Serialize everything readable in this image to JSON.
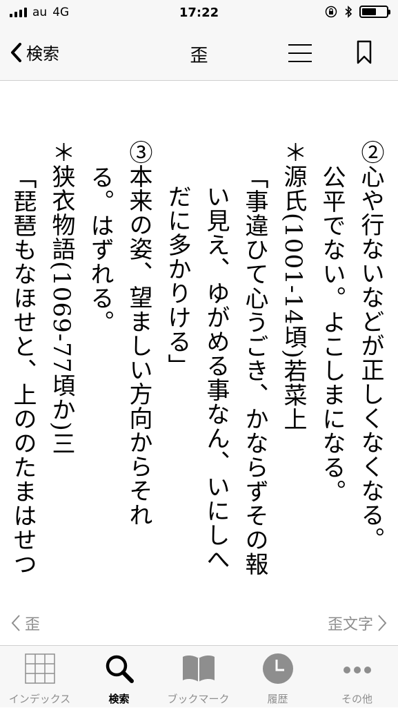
{
  "status": {
    "carrier": "au",
    "network": "4G",
    "time": "17:22"
  },
  "nav": {
    "back_label": "検索",
    "title": "歪"
  },
  "entry": {
    "lines": [
      "②心や行ないなどが正しくなくなる。",
      "公平でない。よこしまになる。",
      "＊源氏(1001‐14頃)若菜上",
      "「事違ひて心うごき、かならずその報",
      "い見え、ゆがめる事なん、いにしへ",
      "だに多かりける」",
      "③本来の姿、望ましい方向からそれ",
      "る。はずれる。",
      "＊狭衣物語(1069‐77頃か)三",
      "「琵琶もなほせと、上ののたまはせつ"
    ]
  },
  "pager": {
    "prev_label": "歪",
    "next_label": "歪文字"
  },
  "tabs": [
    {
      "label": "インデックス",
      "icon": "grid-icon"
    },
    {
      "label": "検索",
      "icon": "search-icon"
    },
    {
      "label": "ブックマーク",
      "icon": "book-icon"
    },
    {
      "label": "履歴",
      "icon": "clock-icon"
    },
    {
      "label": "その他",
      "icon": "more-icon"
    }
  ],
  "colors": {
    "bar_bg": "#f7f7f7",
    "inactive": "#8e8e8e",
    "active": "#000000"
  }
}
